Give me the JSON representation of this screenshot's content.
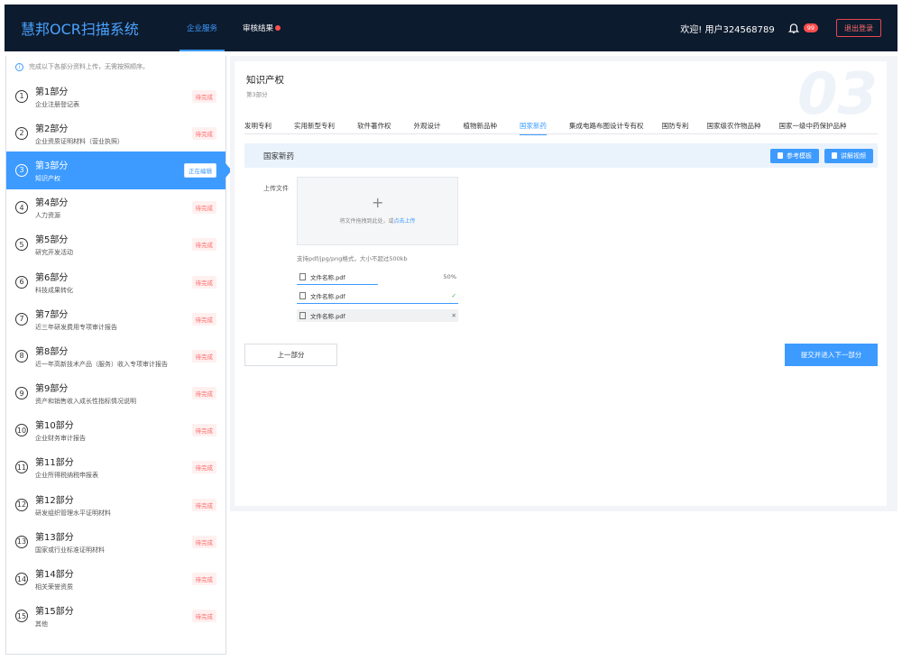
{
  "header": {
    "logo": "慧邦OCR扫描系统",
    "nav": [
      {
        "label": "企业服务",
        "active": true
      },
      {
        "label": "审核结果",
        "active": false,
        "dot": true
      }
    ],
    "welcome": "欢迎!  用户324568789",
    "notification_count": "99",
    "logout_label": "退出登录"
  },
  "sidebar": {
    "tip": "完成以下各部分资料上传，无需按照顺序。",
    "items": [
      {
        "num": "1",
        "title": "第1部分",
        "sub": "企业注册登记表",
        "status": "待完成"
      },
      {
        "num": "2",
        "title": "第2部分",
        "sub": "企业资质证明材料（营业执照）",
        "status": "待完成"
      },
      {
        "num": "3",
        "title": "第3部分",
        "sub": "知识产权",
        "status": "正在编辑",
        "active": true
      },
      {
        "num": "4",
        "title": "第4部分",
        "sub": "人力资源",
        "status": "待完成"
      },
      {
        "num": "5",
        "title": "第5部分",
        "sub": "研究开发活动",
        "status": "待完成"
      },
      {
        "num": "6",
        "title": "第6部分",
        "sub": "科技成果转化",
        "status": "待完成"
      },
      {
        "num": "7",
        "title": "第7部分",
        "sub": "近三年研发费用专项审计报告",
        "status": "待完成"
      },
      {
        "num": "8",
        "title": "第8部分",
        "sub": "近一年高新技术产品（服务）收入专项审计报告",
        "status": "待完成"
      },
      {
        "num": "9",
        "title": "第9部分",
        "sub": "资产和销售收入成长性指标情况说明",
        "status": "待完成"
      },
      {
        "num": "10",
        "title": "第10部分",
        "sub": "企业财务审计报告",
        "status": "待完成"
      },
      {
        "num": "11",
        "title": "第11部分",
        "sub": "企业所得税纳税申报表",
        "status": "待完成"
      },
      {
        "num": "12",
        "title": "第12部分",
        "sub": "研发组织管理水平证明材料",
        "status": "待完成"
      },
      {
        "num": "13",
        "title": "第13部分",
        "sub": "国家或行业标准证明材料",
        "status": "待完成"
      },
      {
        "num": "14",
        "title": "第14部分",
        "sub": "相关荣誉资质",
        "status": "待完成"
      },
      {
        "num": "15",
        "title": "第15部分",
        "sub": "其他",
        "status": "待完成"
      }
    ]
  },
  "panel": {
    "title": "知识产权",
    "subtitle": "第3部分",
    "watermark": "03",
    "tabs": [
      {
        "label": "发明专利"
      },
      {
        "label": "实用新型专利"
      },
      {
        "label": "软件著作权"
      },
      {
        "label": "外观设计"
      },
      {
        "label": "植物新品种"
      },
      {
        "label": "国家新药",
        "active": true
      },
      {
        "label": "集成电路布图设计专有权"
      },
      {
        "label": "国防专利"
      },
      {
        "label": "国家级农作物品种"
      },
      {
        "label": "国家一级中药保护品种"
      }
    ],
    "section_title": "国家新药",
    "template_button": "参考模板",
    "video_button": "讲解视频",
    "upload_label": "上传文件",
    "drop_text": "将文件拖拽到此处，或",
    "drop_link": "点击上传",
    "upload_hint": "支持pdf/jpg/png格式，大小不超过500kb",
    "files": [
      {
        "name": "文件名称.pdf",
        "right": "50%",
        "progress": 0.5,
        "state": "uploading"
      },
      {
        "name": "文件名称.pdf",
        "right": "✓",
        "progress": 1.0,
        "state": "done"
      },
      {
        "name": "文件名称.pdf",
        "right": "✕",
        "state": "grey"
      }
    ],
    "prev_button": "上一部分",
    "next_button": "提交并进入下一部分"
  },
  "colors": {
    "header_bg": "#0d1b2e",
    "accent": "#3d9bff",
    "danger": "#ff4d4f",
    "success": "#27b148"
  }
}
